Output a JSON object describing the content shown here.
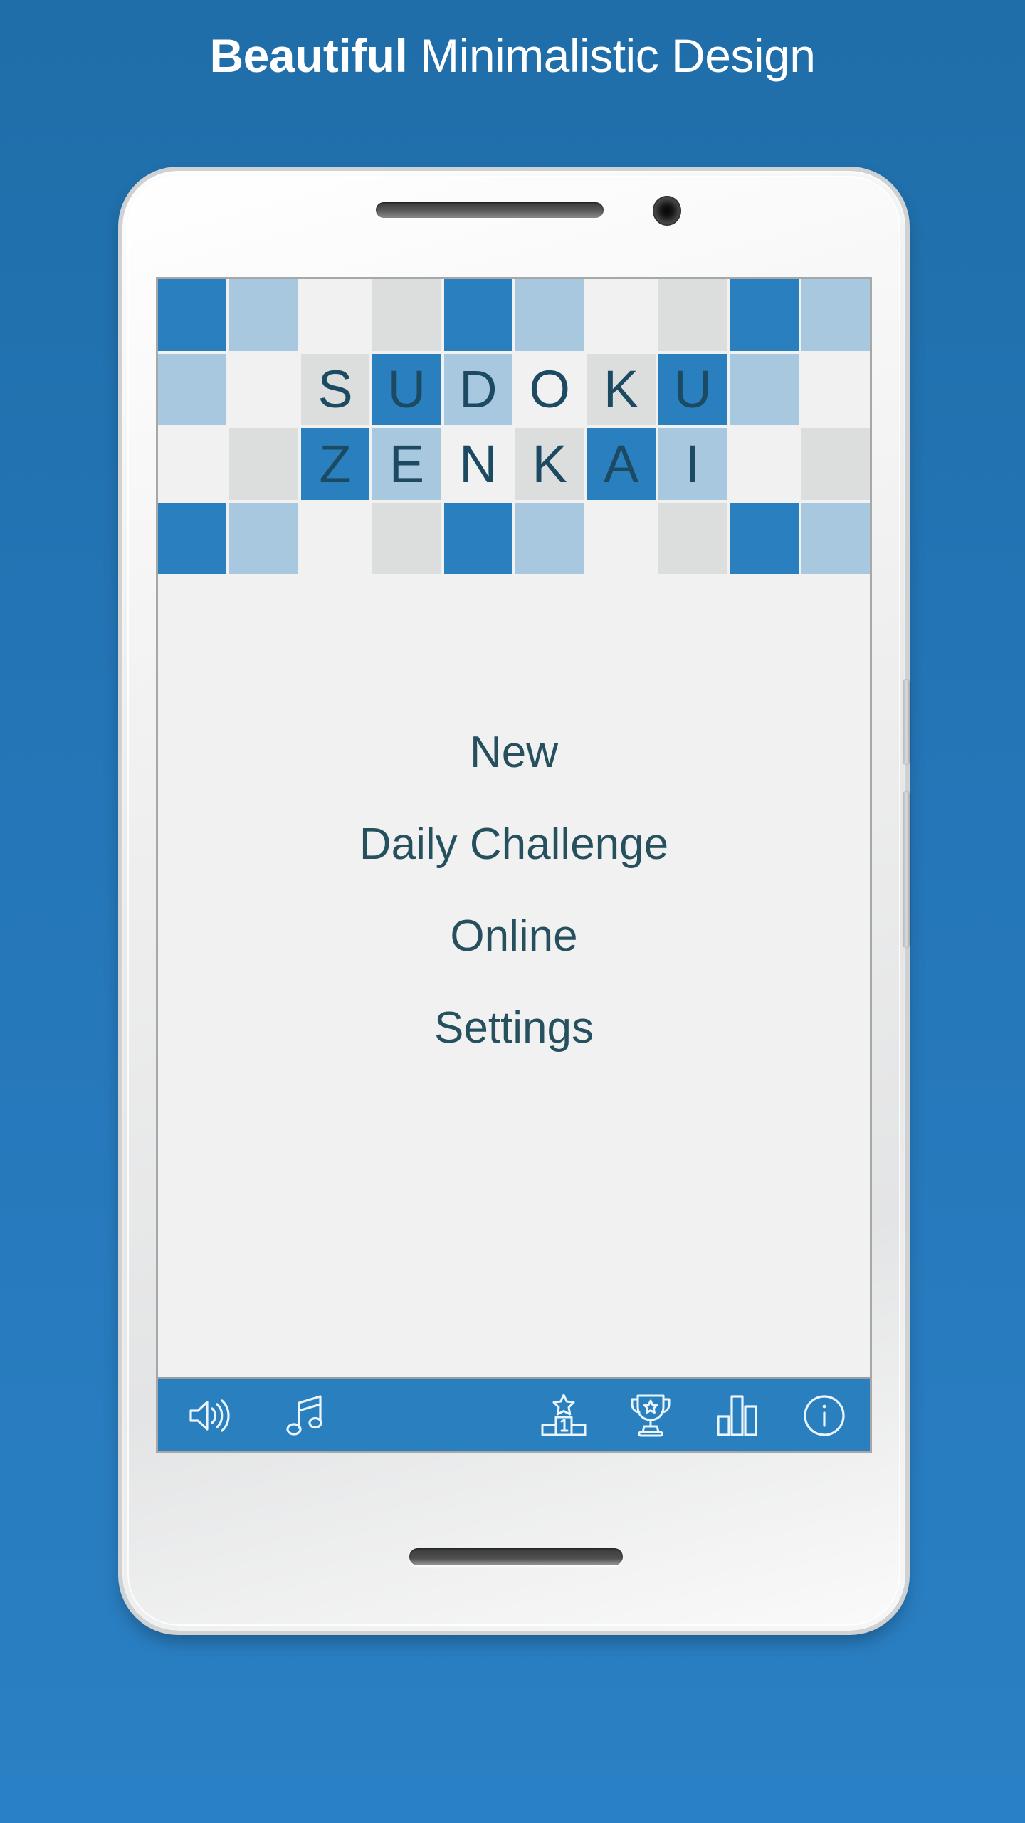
{
  "headline": {
    "bold_part": "Beautiful",
    "light_part": " Minimalistic Design"
  },
  "colors": {
    "background_blue": "#2476b8",
    "accent_blue": "#2a7fbe",
    "cell_light_blue": "#a7c8de",
    "cell_gray": "#dcdddd",
    "cell_white": "#f0f1f0",
    "text_dark": "#27505f",
    "letter_color": "#1d4a63"
  },
  "app": {
    "logo": {
      "line1": "SUDOKU",
      "line2": "ZENKAI",
      "grid": {
        "columns": 10,
        "rows": 4,
        "row1": [
          "dark",
          "light",
          "white",
          "gray",
          "dark",
          "light",
          "white",
          "gray",
          "dark",
          "light"
        ],
        "row2": [
          "light",
          "white",
          "gray",
          "dark",
          "light",
          "white",
          "gray",
          "dark",
          "light",
          "white"
        ],
        "row3": [
          "white",
          "gray",
          "dark",
          "light",
          "white",
          "gray",
          "dark",
          "light",
          "white",
          "gray"
        ],
        "row4": [
          "dark",
          "light",
          "white",
          "gray",
          "dark",
          "light",
          "white",
          "gray",
          "dark",
          "light"
        ],
        "letters_row2": [
          "",
          "",
          "S",
          "U",
          "D",
          "O",
          "K",
          "U",
          "",
          ""
        ],
        "letters_row3": [
          "",
          "",
          "Z",
          "E",
          "N",
          "K",
          "A",
          "I",
          "",
          ""
        ]
      }
    },
    "menu": [
      {
        "label": "New",
        "name": "menu-item-new"
      },
      {
        "label": "Daily Challenge",
        "name": "menu-item-daily-challenge"
      },
      {
        "label": "Online",
        "name": "menu-item-online"
      },
      {
        "label": "Settings",
        "name": "menu-item-settings"
      }
    ],
    "toolbar": {
      "left_icons": [
        {
          "icon": "sound-icon",
          "label": "Sound"
        },
        {
          "icon": "music-note-icon",
          "label": "Music"
        }
      ],
      "right_icons": [
        {
          "icon": "leaderboard-podium-icon",
          "label": "Leaderboard",
          "podium_number": "1"
        },
        {
          "icon": "trophy-icon",
          "label": "Achievements"
        },
        {
          "icon": "bar-chart-icon",
          "label": "Statistics"
        },
        {
          "icon": "info-icon",
          "label": "Info"
        }
      ]
    }
  },
  "device": {
    "earpiece": "earpiece-speaker",
    "camera": "front-camera",
    "bottom_speaker": "bottom-speaker",
    "power_button": "power-button",
    "volume_button": "volume-button"
  }
}
